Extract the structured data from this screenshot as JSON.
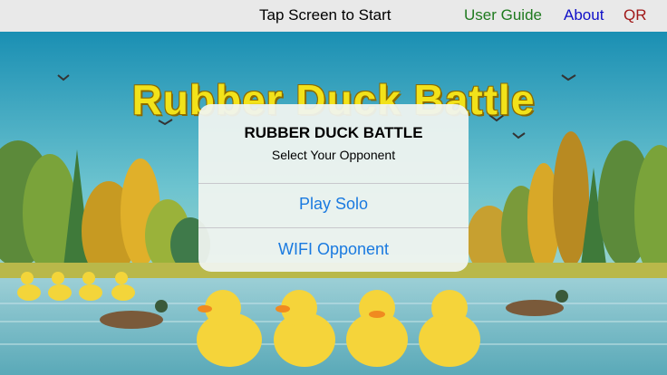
{
  "topbar": {
    "tap_label": "Tap Screen to Start",
    "user_guide_label": "User Guide",
    "about_label": "About",
    "qr_label": "QR"
  },
  "game": {
    "title": "Rubber Duck Battle"
  },
  "dialog": {
    "title": "RUBBER DUCK BATTLE",
    "subtitle": "Select Your Opponent",
    "play_solo_label": "Play Solo",
    "wifi_label": "WIFI Opponent"
  },
  "colors": {
    "sky": "#2aa0c0",
    "title_yellow": "#f2e21a",
    "link_blue": "#1a7ae0"
  }
}
